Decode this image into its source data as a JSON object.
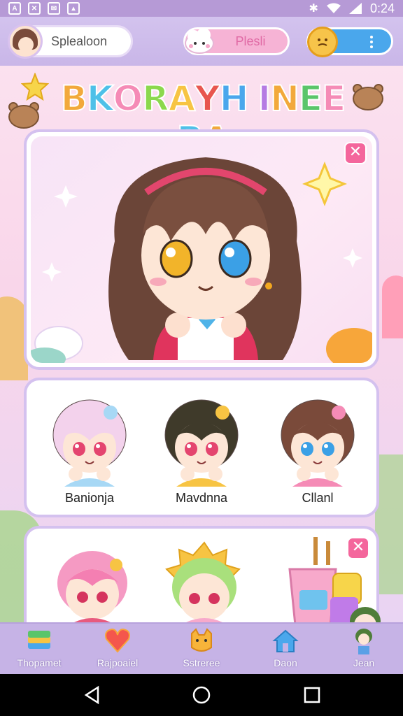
{
  "status_bar": {
    "time": "0:24",
    "left_icons": [
      "a-notification-icon",
      "crossed-box-icon",
      "mail-icon",
      "image-icon"
    ],
    "right_icons": [
      "bluetooth-icon",
      "wifi-icon",
      "signal-icon"
    ]
  },
  "header": {
    "profile_name": "Splealoon",
    "center_label": "Plesli",
    "menu_icon": "vertical-dots-icon"
  },
  "title": {
    "text": "BKORAYH INEEBA",
    "colors": [
      "#f2a93b",
      "#4ec0e8",
      "#f58bb6",
      "#8bd84c",
      "#f7c443",
      "#e8574f",
      "#4aa7ec",
      "#b57be3",
      "#f2a93b",
      "#5ac56a",
      "#f58bb6",
      "#4ec0e8",
      "#f2a93b",
      "#e8574f"
    ]
  },
  "hero": {
    "close_symbol": "✕"
  },
  "characters_row1": [
    {
      "name": "Banionja",
      "hair": "#f3d2ec",
      "accent": "#a7d8f5",
      "eyes": "#e4456f"
    },
    {
      "name": "Mavdnna",
      "hair": "#3f3a2a",
      "accent": "#f7c443",
      "eyes": "#e4456f"
    },
    {
      "name": "Cllanl",
      "hair": "#7a4a3a",
      "accent": "#f58bb6",
      "eyes": "#3ba0e6"
    }
  ],
  "characters_row2": {
    "close_symbol": "✕"
  },
  "bottom_nav": [
    {
      "label": "Thopamet",
      "icon": "layers-icon"
    },
    {
      "label": "Rajpoaiel",
      "icon": "heart-icon"
    },
    {
      "label": "Sstreree",
      "icon": "cat-face-icon"
    },
    {
      "label": "Daon",
      "icon": "house-icon"
    },
    {
      "label": "Jean",
      "icon": "character-avatar-icon"
    }
  ],
  "colors": {
    "accent_purple": "#c6b3e6",
    "accent_pink": "#f4669c",
    "accent_blue": "#4aa7ec",
    "accent_yellow": "#f7c44a"
  }
}
